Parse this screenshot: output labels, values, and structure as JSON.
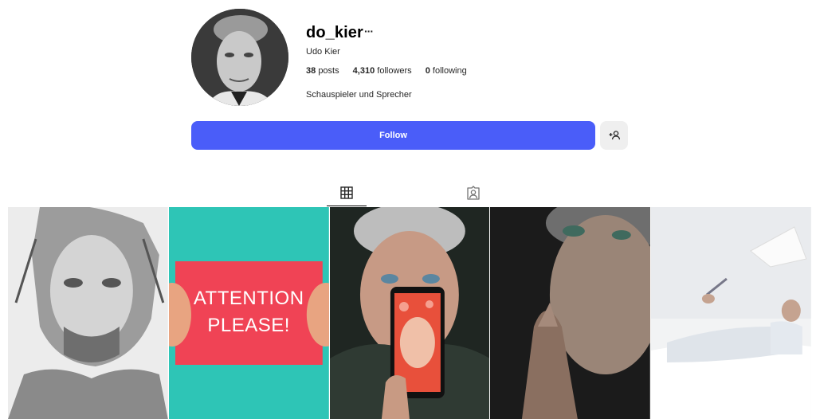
{
  "profile": {
    "username": "do_kier",
    "full_name": "Udo Kier",
    "bio": "Schauspieler und Sprecher",
    "stats": {
      "posts_count": "38",
      "posts_label": "posts",
      "followers_count": "4,310",
      "followers_label": "followers",
      "following_count": "0",
      "following_label": "following"
    }
  },
  "actions": {
    "follow_label": "Follow",
    "more_label": "···"
  },
  "tabs": [
    {
      "icon": "grid-icon",
      "active": true
    },
    {
      "icon": "tagged-icon",
      "active": false
    }
  ],
  "posts": [
    {
      "icon": "sketch-portrait-image"
    },
    {
      "icon": "attention-please-image",
      "text_line1": "ATTENTION",
      "text_line2": "PLEASE!"
    },
    {
      "icon": "phone-portrait-image"
    },
    {
      "icon": "pointing-man-image"
    },
    {
      "icon": "bed-man-image"
    }
  ],
  "colors": {
    "accent": "#4a5df9",
    "secondary_button": "#efefef",
    "teal": "#2ec5b6",
    "sign_red": "#f04355"
  }
}
